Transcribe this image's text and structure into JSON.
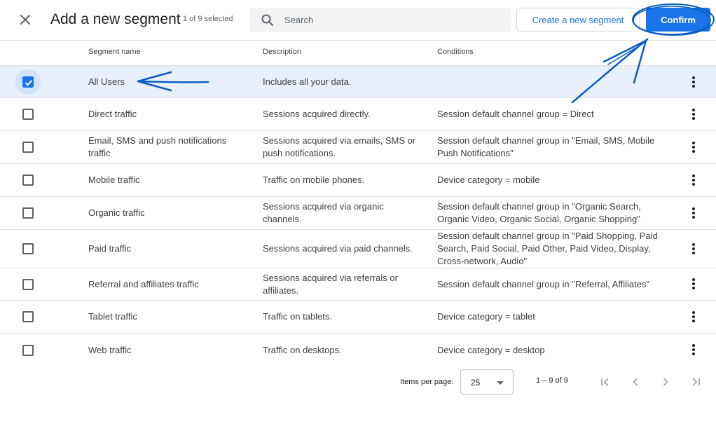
{
  "header": {
    "title": "Add a new segment",
    "selected_count": "1 of 9 selected",
    "search_placeholder": "Search",
    "create_button": "Create a new segment",
    "confirm_button": "Confirm"
  },
  "columns": {
    "name": "Segment name",
    "description": "Description",
    "conditions": "Conditions"
  },
  "rows": [
    {
      "name": "All Users",
      "description": "Includes all your data.",
      "conditions": "",
      "checked": true
    },
    {
      "name": "Direct traffic",
      "description": "Sessions acquired directly.",
      "conditions": "Session default channel group = Direct",
      "checked": false
    },
    {
      "name": "Email, SMS and push notifications traffic",
      "description": "Sessions acquired via emails, SMS or push notifications.",
      "conditions": "Session default channel group in \"Email, SMS, Mobile Push Notifications\"",
      "checked": false
    },
    {
      "name": "Mobile traffic",
      "description": "Traffic on mobile phones.",
      "conditions": "Device category = mobile",
      "checked": false
    },
    {
      "name": "Organic traffic",
      "description": "Sessions acquired via organic channels.",
      "conditions": "Session default channel group in \"Organic Search, Organic Video, Organic Social, Organic Shopping\"",
      "checked": false
    },
    {
      "name": "Paid traffic",
      "description": "Sessions acquired via paid channels.",
      "conditions": "Session default channel group in \"Paid Shopping, Paid Search, Paid Social, Paid Other, Paid Video, Display, Cross-network, Audio\"",
      "checked": false
    },
    {
      "name": "Referral and affiliates traffic",
      "description": "Sessions acquired via referrals or affiliates.",
      "conditions": "Session default channel group in \"Referral, Affiliates\"",
      "checked": false
    },
    {
      "name": "Tablet traffic",
      "description": "Traffic on tablets.",
      "conditions": "Device category = tablet",
      "checked": false
    },
    {
      "name": "Web traffic",
      "description": "Traffic on desktops.",
      "conditions": "Device category = desktop",
      "checked": false
    }
  ],
  "pagination": {
    "items_per_page_label": "Items per page:",
    "items_per_page_value": "25",
    "range": "1 – 9 of 9"
  },
  "colors": {
    "accent": "#1a73e8",
    "selected_row": "#e8f0fe",
    "annotation": "#0b5cc2"
  }
}
